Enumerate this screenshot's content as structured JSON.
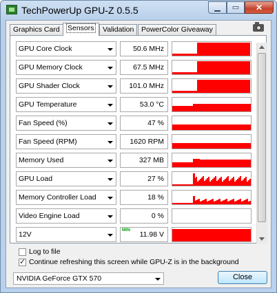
{
  "window": {
    "title": "TechPowerUp GPU-Z 0.5.5",
    "close_glyph": "✕",
    "max_glyph": "▭",
    "min_glyph": "▁"
  },
  "tabs": [
    {
      "label": "Graphics Card"
    },
    {
      "label": "Sensors"
    },
    {
      "label": "Validation"
    },
    {
      "label": "PowerColor Giveaway"
    }
  ],
  "sensors": [
    {
      "label": "GPU Core Clock",
      "value": "50.6 MHz",
      "graph": "clock"
    },
    {
      "label": "GPU Memory Clock",
      "value": "67.5 MHz",
      "graph": "clock"
    },
    {
      "label": "GPU Shader Clock",
      "value": "101.0 MHz",
      "graph": "clock"
    },
    {
      "label": "GPU Temperature",
      "value": "53.0 °C",
      "graph": "temp"
    },
    {
      "label": "Fan Speed (%)",
      "value": "47 %",
      "graph": "fan"
    },
    {
      "label": "Fan Speed (RPM)",
      "value": "1620 RPM",
      "graph": "fan"
    },
    {
      "label": "Memory Used",
      "value": "327 MB",
      "graph": "mem"
    },
    {
      "label": "GPU Load",
      "value": "27 %",
      "graph": "load"
    },
    {
      "label": "Memory Controller Load",
      "value": "18 %",
      "graph": "mcload"
    },
    {
      "label": "Video Engine Load",
      "value": "0 %",
      "graph": "none"
    },
    {
      "label": "12V",
      "value": "11.98 V",
      "graph": "volt",
      "min_tag": "MIN"
    }
  ],
  "options": {
    "log_to_file": {
      "label": "Log to file",
      "checked": false
    },
    "continue_refresh": {
      "label": "Continue refreshing this screen while GPU-Z is in the background",
      "checked": true
    }
  },
  "footer": {
    "gpu_select": "NVIDIA GeForce GTX 570",
    "close_label": "Close"
  },
  "colors": {
    "graph": "#ff0000",
    "accent_button": "#3c7fb1"
  }
}
